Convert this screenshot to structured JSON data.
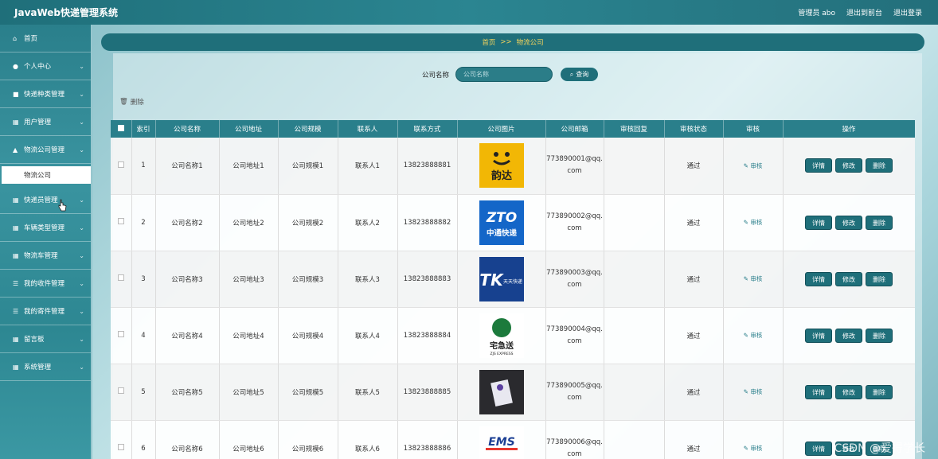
{
  "app": {
    "title": "JavaWeb快递管理系统"
  },
  "header": {
    "admin": "管理员 abo",
    "back_front": "退出到前台",
    "logout": "退出登录"
  },
  "sidebar": {
    "items": [
      {
        "label": "首页",
        "icon": "home-icon",
        "glyph": "⌂"
      },
      {
        "label": "个人中心",
        "icon": "user-icon",
        "glyph": "●"
      },
      {
        "label": "快递种类管理",
        "icon": "truck-icon",
        "glyph": "■"
      },
      {
        "label": "用户管理",
        "icon": "grid-icon",
        "glyph": "▦"
      },
      {
        "label": "物流公司管理",
        "icon": "building-icon",
        "glyph": "▲"
      },
      {
        "label": "快递员管理",
        "icon": "grid-icon",
        "glyph": "▦"
      },
      {
        "label": "车辆类型管理",
        "icon": "grid-icon",
        "glyph": "▦"
      },
      {
        "label": "物流车管理",
        "icon": "grid-icon",
        "glyph": "▦"
      },
      {
        "label": "我的收件管理",
        "icon": "sliders-icon",
        "glyph": "☰"
      },
      {
        "label": "我的寄件管理",
        "icon": "list-icon",
        "glyph": "☰"
      },
      {
        "label": "留言板",
        "icon": "grid-icon",
        "glyph": "▦"
      },
      {
        "label": "系统管理",
        "icon": "grid-icon",
        "glyph": "▦"
      }
    ],
    "sub_active": "物流公司"
  },
  "breadcrumb": {
    "home": "首页",
    "sep": ">>",
    "current": "物流公司"
  },
  "search": {
    "label": "公司名称",
    "placeholder": "公司名称",
    "button": "查询"
  },
  "toolbar": {
    "delete": "删除"
  },
  "table": {
    "headers": [
      "索引",
      "公司名称",
      "公司地址",
      "公司规模",
      "联系人",
      "联系方式",
      "公司图片",
      "公司邮箱",
      "审核回复",
      "审核状态",
      "审核",
      "操作"
    ],
    "rows": [
      {
        "idx": "1",
        "name": "公司名称1",
        "addr": "公司地址1",
        "scale": "公司规模1",
        "contact": "联系人1",
        "phone": "13823888881",
        "logo": "韵达",
        "email1": "773890001@qq.",
        "email2": "com",
        "reply": "",
        "status": "通过"
      },
      {
        "idx": "2",
        "name": "公司名称2",
        "addr": "公司地址2",
        "scale": "公司规模2",
        "contact": "联系人2",
        "phone": "13823888882",
        "logo": "中通快递",
        "email1": "773890002@qq.",
        "email2": "com",
        "reply": "",
        "status": "通过"
      },
      {
        "idx": "3",
        "name": "公司名称3",
        "addr": "公司地址3",
        "scale": "公司规模3",
        "contact": "联系人3",
        "phone": "13823888883",
        "logo": "天天快递",
        "email1": "773890003@qq.",
        "email2": "com",
        "reply": "",
        "status": "通过"
      },
      {
        "idx": "4",
        "name": "公司名称4",
        "addr": "公司地址4",
        "scale": "公司规模4",
        "contact": "联系人4",
        "phone": "13823888884",
        "logo": "宅急送",
        "email1": "773890004@qq.",
        "email2": "com",
        "reply": "",
        "status": "通过"
      },
      {
        "idx": "5",
        "name": "公司名称5",
        "addr": "公司地址5",
        "scale": "公司规模5",
        "contact": "联系人5",
        "phone": "13823888885",
        "logo": "",
        "email1": "773890005@qq.",
        "email2": "com",
        "reply": "",
        "status": "通过"
      },
      {
        "idx": "6",
        "name": "公司名称6",
        "addr": "公司地址6",
        "scale": "公司规模6",
        "contact": "联系人6",
        "phone": "13823888886",
        "logo": "EMS",
        "email1": "773890006@qq.",
        "email2": "com",
        "reply": "",
        "status": "通过"
      }
    ],
    "audit_label": "审核",
    "actions": {
      "detail": "详情",
      "edit": "修改",
      "delete": "删除"
    }
  },
  "watermark": "CSDN @爱得学长",
  "colors": {
    "primary": "#1f6f7a",
    "header": "#2a7f8b",
    "breadcrumb_text": "#f3d35c"
  }
}
